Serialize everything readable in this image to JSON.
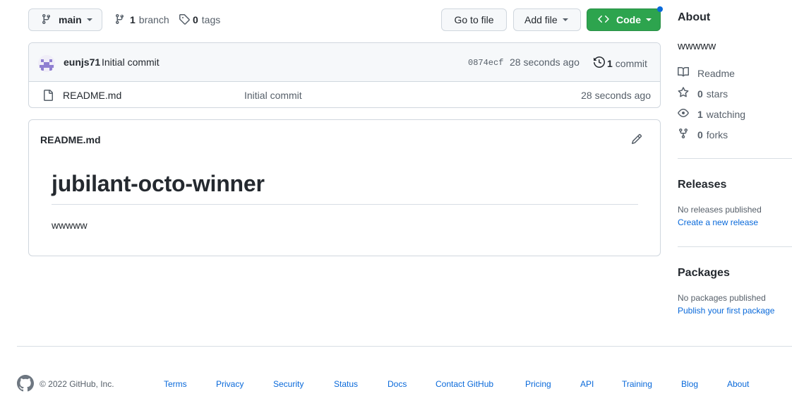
{
  "toolbar": {
    "branch_name": "main",
    "branch_count": "1",
    "branch_label": "branch",
    "tag_count": "0",
    "tag_label": "tags",
    "go_to_file": "Go to file",
    "add_file": "Add file",
    "code": "Code"
  },
  "latest_commit": {
    "author": "eunjs71",
    "message": "Initial commit",
    "sha": "0874ecf",
    "time": "28 seconds ago",
    "commit_count": "1",
    "commit_label": "commit"
  },
  "files": [
    {
      "name": "README.md",
      "message": "Initial commit",
      "time": "28 seconds ago",
      "icon": "file-icon"
    }
  ],
  "readme": {
    "filename": "README.md",
    "heading": "jubilant-octo-winner",
    "body": "wwwww"
  },
  "sidebar": {
    "about_title": "About",
    "description": "wwwww",
    "readme_label": "Readme",
    "stars_count": "0",
    "stars_label": "stars",
    "watching_count": "1",
    "watching_label": "watching",
    "forks_count": "0",
    "forks_label": "forks",
    "releases_title": "Releases",
    "releases_empty": "No releases published",
    "create_release": "Create a new release",
    "packages_title": "Packages",
    "packages_empty": "No packages published",
    "publish_package": "Publish your first package"
  },
  "footer": {
    "copyright": "© 2022 GitHub, Inc.",
    "links": [
      "Terms",
      "Privacy",
      "Security",
      "Status",
      "Docs",
      "Contact GitHub",
      "Pricing",
      "API",
      "Training",
      "Blog",
      "About"
    ]
  },
  "colors": {
    "accent": "#0969da",
    "code_button": "#2da44e",
    "border": "#d0d7de",
    "muted_text": "#57606a"
  }
}
